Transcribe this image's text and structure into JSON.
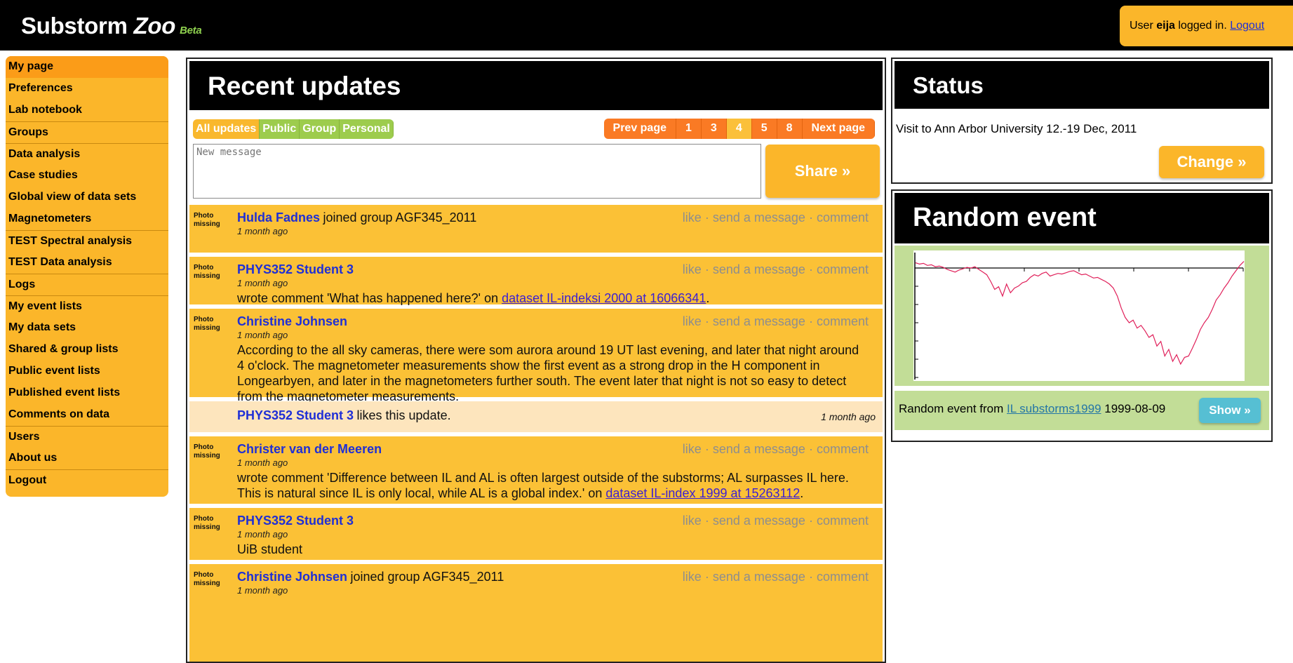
{
  "header": {
    "title_main": "Substorm",
    "title_zoo": "Zoo",
    "beta": "Beta",
    "user_prefix": "User",
    "username": "eija",
    "user_suffix": "logged in.",
    "logout": "Logout"
  },
  "sidebar": {
    "items": [
      {
        "label": "My page"
      },
      {
        "label": "Preferences"
      },
      {
        "label": "Lab notebook"
      },
      {
        "label": "Groups"
      },
      {
        "label": "Data analysis"
      },
      {
        "label": "Case studies"
      },
      {
        "label": "Global view of data sets"
      },
      {
        "label": "Magnetometers"
      },
      {
        "label": "TEST Spectral analysis"
      },
      {
        "label": "TEST Data analysis"
      },
      {
        "label": "Logs"
      },
      {
        "label": "My event lists"
      },
      {
        "label": "My data sets"
      },
      {
        "label": "Shared & group lists"
      },
      {
        "label": "Public event lists"
      },
      {
        "label": "Published event lists"
      },
      {
        "label": "Comments on data"
      },
      {
        "label": "Users"
      },
      {
        "label": "About us"
      },
      {
        "label": "Logout"
      }
    ]
  },
  "updates": {
    "title": "Recent updates",
    "filters": [
      "All updates",
      "Public",
      "Group",
      "Personal"
    ],
    "pager": {
      "prev": "Prev page",
      "pages": [
        "1",
        "3",
        "4",
        "5",
        "8"
      ],
      "current": "4",
      "next": "Next page"
    },
    "message_placeholder": "New message",
    "share_label": "Share »",
    "photo_missing": [
      "Photo",
      "missing"
    ],
    "actions": {
      "like": "like",
      "sep": "·",
      "send": "send a message",
      "comment": "comment"
    },
    "posts": [
      {
        "name": "Hulda Fadnes",
        "text": "joined group AGF345_2011",
        "date": "1 month ago"
      },
      {
        "name": "PHYS352 Student 3",
        "date": "1 month ago",
        "body_prefix": "wrote comment 'What has happened here?' on ",
        "link": "dataset IL-indeksi 2000 at 16066341",
        "body_suffix": "."
      },
      {
        "name": "Christine Johnsen",
        "date": "1 month ago",
        "body": "According to the all sky cameras, there were som aurora around 19 UT last evening, and later that night around 4 o'clock. The magnetometer measurements show the first event as a strong drop in the H component in Longearbyen, and later in the magnetometers further south. The event later that night is not so easy to detect from the magnetometer measurements."
      },
      {
        "name": "PHYS352 Student 3",
        "text": "likes this update.",
        "date": "1 month ago"
      },
      {
        "name": "Christer van der Meeren",
        "date": "1 month ago",
        "body_prefix": "wrote comment 'Difference between IL and AL is often largest outside of the substorms; AL surpasses IL here. This is natural since IL is only local, while AL is a global index.' on ",
        "link": "dataset IL-index 1999 at 15263112",
        "body_suffix": "."
      },
      {
        "name": "PHYS352 Student 3",
        "date": "1 month ago",
        "body": "UiB student"
      },
      {
        "name": "Christine Johnsen",
        "text": "joined group AGF345_2011",
        "date": "1 month ago"
      }
    ]
  },
  "status": {
    "title": "Status",
    "text": "Visit to Ann Arbor University 12.-19 Dec, 2011",
    "change_label": "Change »"
  },
  "random_event": {
    "title": "Random event",
    "prefix": "Random event from",
    "link": "IL substorms1999",
    "date": "1999-08-09",
    "show_label": "Show »",
    "line_color": "#e0205a",
    "series_y": [
      10,
      12,
      11,
      14,
      13,
      16,
      15,
      17,
      20,
      22,
      24,
      21,
      19,
      17,
      18,
      16,
      20,
      24,
      28,
      38,
      50,
      46,
      60,
      42,
      55,
      48,
      45,
      40,
      38,
      32,
      28,
      30,
      26,
      24,
      30,
      28,
      26,
      27,
      25,
      23,
      22,
      25,
      28,
      27,
      30,
      33,
      32,
      35,
      38,
      42,
      48,
      60,
      78,
      92,
      100,
      96,
      108,
      104,
      112,
      122,
      118,
      135,
      128,
      150,
      140,
      158,
      148,
      162,
      152,
      150,
      138,
      125,
      110,
      100,
      92,
      80,
      66,
      58,
      48,
      40,
      30,
      22,
      14,
      8
    ]
  }
}
